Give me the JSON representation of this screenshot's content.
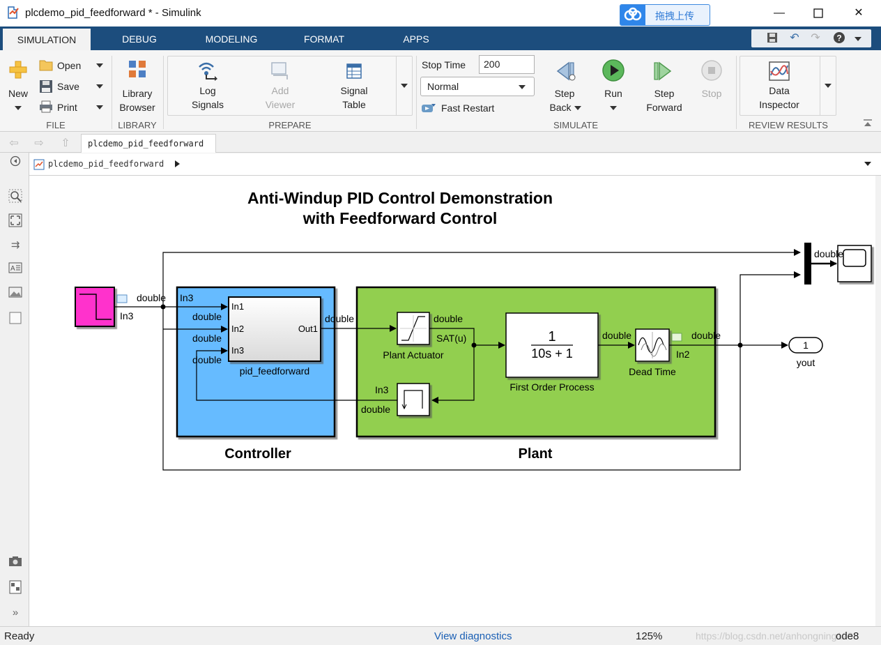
{
  "window": {
    "title": "plcdemo_pid_feedforward * - Simulink",
    "cloud_upload_label": "拖拽上传"
  },
  "tabs": [
    {
      "label": "SIMULATION",
      "active": true
    },
    {
      "label": "DEBUG"
    },
    {
      "label": "MODELING"
    },
    {
      "label": "FORMAT"
    },
    {
      "label": "APPS"
    }
  ],
  "ribbon": {
    "file": {
      "new_label": "New",
      "open_label": "Open",
      "save_label": "Save",
      "print_label": "Print",
      "group_label": "FILE"
    },
    "library": {
      "browser_line1": "Library",
      "browser_line2": "Browser",
      "group_label": "LIBRARY"
    },
    "prepare": {
      "log_line1": "Log",
      "log_line2": "Signals",
      "add_line1": "Add",
      "add_line2": "Viewer",
      "table_line1": "Signal",
      "table_line2": "Table",
      "group_label": "PREPARE"
    },
    "simulate": {
      "stop_time_label": "Stop Time",
      "stop_time_value": "200",
      "mode_value": "Normal",
      "fast_restart_label": "Fast Restart",
      "step_back_line1": "Step",
      "step_back_line2": "Back",
      "run_label": "Run",
      "step_fwd_line1": "Step",
      "step_fwd_line2": "Forward",
      "stop_label": "Stop",
      "group_label": "SIMULATE"
    },
    "review": {
      "inspector_line1": "Data",
      "inspector_line2": "Inspector",
      "group_label": "REVIEW RESULTS"
    }
  },
  "navigation": {
    "model_tab": "plcdemo_pid_feedforward",
    "breadcrumb": "plcdemo_pid_feedforward"
  },
  "diagram": {
    "title_line1": "Anti-Windup PID Control Demonstration",
    "title_line2": "with Feedforward Control",
    "controller_label": "Controller",
    "plant_label": "Plant",
    "pid_block_name": "pid_feedforward",
    "pid_ports_in": [
      "In1",
      "In2",
      "In3"
    ],
    "pid_port_out": "Out1",
    "actuator_name": "Plant Actuator",
    "actuator_port": "SAT(u)",
    "process_name": "First Order Process",
    "tf_numerator": "1",
    "tf_denominator": "10s + 1",
    "dead_time_name": "Dead Time",
    "step_label": "In3",
    "in3_label_controller": "In3",
    "in3_label_plant": "In3",
    "in2_label": "In2",
    "signal_type": "double",
    "outport_number": "1",
    "outport_name": "yout",
    "colors": {
      "controller_fill": "#66bbff",
      "plant_fill": "#92cf50",
      "step_fill": "#ff33cc"
    }
  },
  "status": {
    "ready": "Ready",
    "diagnostics": "View diagnostics",
    "zoom": "125%",
    "solver": "ode8",
    "watermark": "https://blog.csdn.net/anhongning123"
  }
}
